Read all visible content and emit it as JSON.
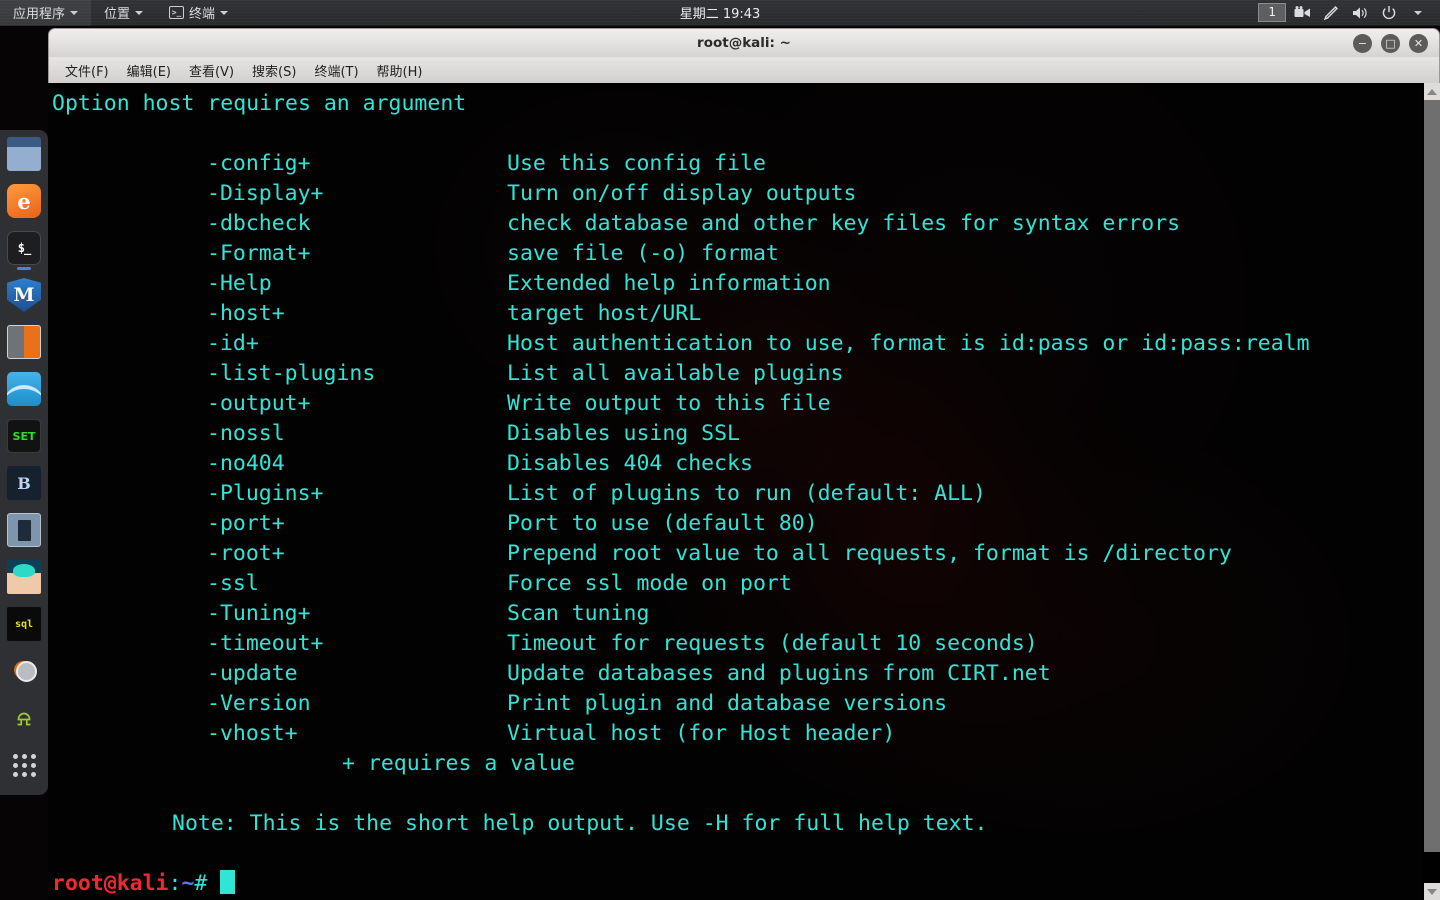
{
  "topbar": {
    "menus": [
      {
        "label": "应用程序",
        "icon": ""
      },
      {
        "label": "位置",
        "icon": ""
      },
      {
        "label": "终端",
        "icon": "terminal-icon"
      }
    ],
    "clock": "星期二 19:43",
    "workspace": "1",
    "tray": [
      {
        "name": "screencast-icon",
        "glyph": "🎥"
      },
      {
        "name": "pen-icon",
        "glyph": "✎"
      },
      {
        "name": "volume-icon",
        "glyph": "🔊"
      },
      {
        "name": "power-icon",
        "glyph": "⏻"
      },
      {
        "name": "chevron-down-icon",
        "glyph": "▾"
      }
    ]
  },
  "dock": {
    "items": [
      {
        "name": "files",
        "label": "Files"
      },
      {
        "name": "firefox",
        "label": "Firefox ESR",
        "glyph": "e"
      },
      {
        "name": "terminal",
        "label": "Terminal",
        "glyph": "$_",
        "active": true
      },
      {
        "name": "metasploit",
        "label": "Metasploit Framework",
        "glyph": "M"
      },
      {
        "name": "burpsuite",
        "label": "Burp Suite"
      },
      {
        "name": "wireshark",
        "label": "Wireshark"
      },
      {
        "name": "set",
        "label": "SET",
        "glyph": "SET"
      },
      {
        "name": "beef",
        "label": "BeEF",
        "glyph": "B"
      },
      {
        "name": "armitage",
        "label": "Armitage"
      },
      {
        "name": "maltego",
        "label": "Maltego"
      },
      {
        "name": "sqlmap",
        "label": "sqlmap",
        "glyph": "sql"
      },
      {
        "name": "zenmap",
        "label": "Zenmap"
      },
      {
        "name": "android-tools",
        "label": "Android Tools",
        "glyph": "⍾"
      },
      {
        "name": "show-applications",
        "label": "Show Applications"
      }
    ]
  },
  "window": {
    "title": "root@kali: ~",
    "buttons": {
      "minimize": "−",
      "maximize": "□",
      "close": "✕"
    },
    "menubar": [
      "文件(F)",
      "编辑(E)",
      "查看(V)",
      "搜索(S)",
      "终端(T)",
      "帮助(H)"
    ]
  },
  "terminal": {
    "error_line": "Option host requires an argument",
    "options": [
      {
        "flag": "-config+",
        "desc": "Use this config file"
      },
      {
        "flag": "-Display+",
        "desc": "Turn on/off display outputs"
      },
      {
        "flag": "-dbcheck",
        "desc": "check database and other key files for syntax errors"
      },
      {
        "flag": "-Format+",
        "desc": "save file (-o) format"
      },
      {
        "flag": "-Help",
        "desc": "Extended help information"
      },
      {
        "flag": "-host+",
        "desc": "target host/URL"
      },
      {
        "flag": "-id+",
        "desc": "Host authentication to use, format is id:pass or id:pass:realm"
      },
      {
        "flag": "-list-plugins",
        "desc": "List all available plugins"
      },
      {
        "flag": "-output+",
        "desc": "Write output to this file"
      },
      {
        "flag": "-nossl",
        "desc": "Disables using SSL"
      },
      {
        "flag": "-no404",
        "desc": "Disables 404 checks"
      },
      {
        "flag": "-Plugins+",
        "desc": "List of plugins to run (default: ALL)"
      },
      {
        "flag": "-port+",
        "desc": "Port to use (default 80)"
      },
      {
        "flag": "-root+",
        "desc": "Prepend root value to all requests, format is /directory"
      },
      {
        "flag": "-ssl",
        "desc": "Force ssl mode on port"
      },
      {
        "flag": "-Tuning+",
        "desc": "Scan tuning"
      },
      {
        "flag": "-timeout+",
        "desc": "Timeout for requests (default 10 seconds)"
      },
      {
        "flag": "-update",
        "desc": "Update databases and plugins from CIRT.net"
      },
      {
        "flag": "-Version",
        "desc": "Print plugin and database versions"
      },
      {
        "flag": "-vhost+",
        "desc": "Virtual host (for Host header)"
      }
    ],
    "plus_note": "+ requires a value",
    "footer_note": "Note: This is the short help output. Use -H for full help text.",
    "prompt": {
      "user_host": "root@kali",
      "colon": ":",
      "path": "~",
      "symbol": "#"
    }
  },
  "colors": {
    "terminal_text": "#2fe6d6",
    "prompt_user": "#f02832",
    "prompt_path": "#5d72e8",
    "dock_bg": "#2e3033",
    "panel_bg": "#2a2b2d"
  }
}
